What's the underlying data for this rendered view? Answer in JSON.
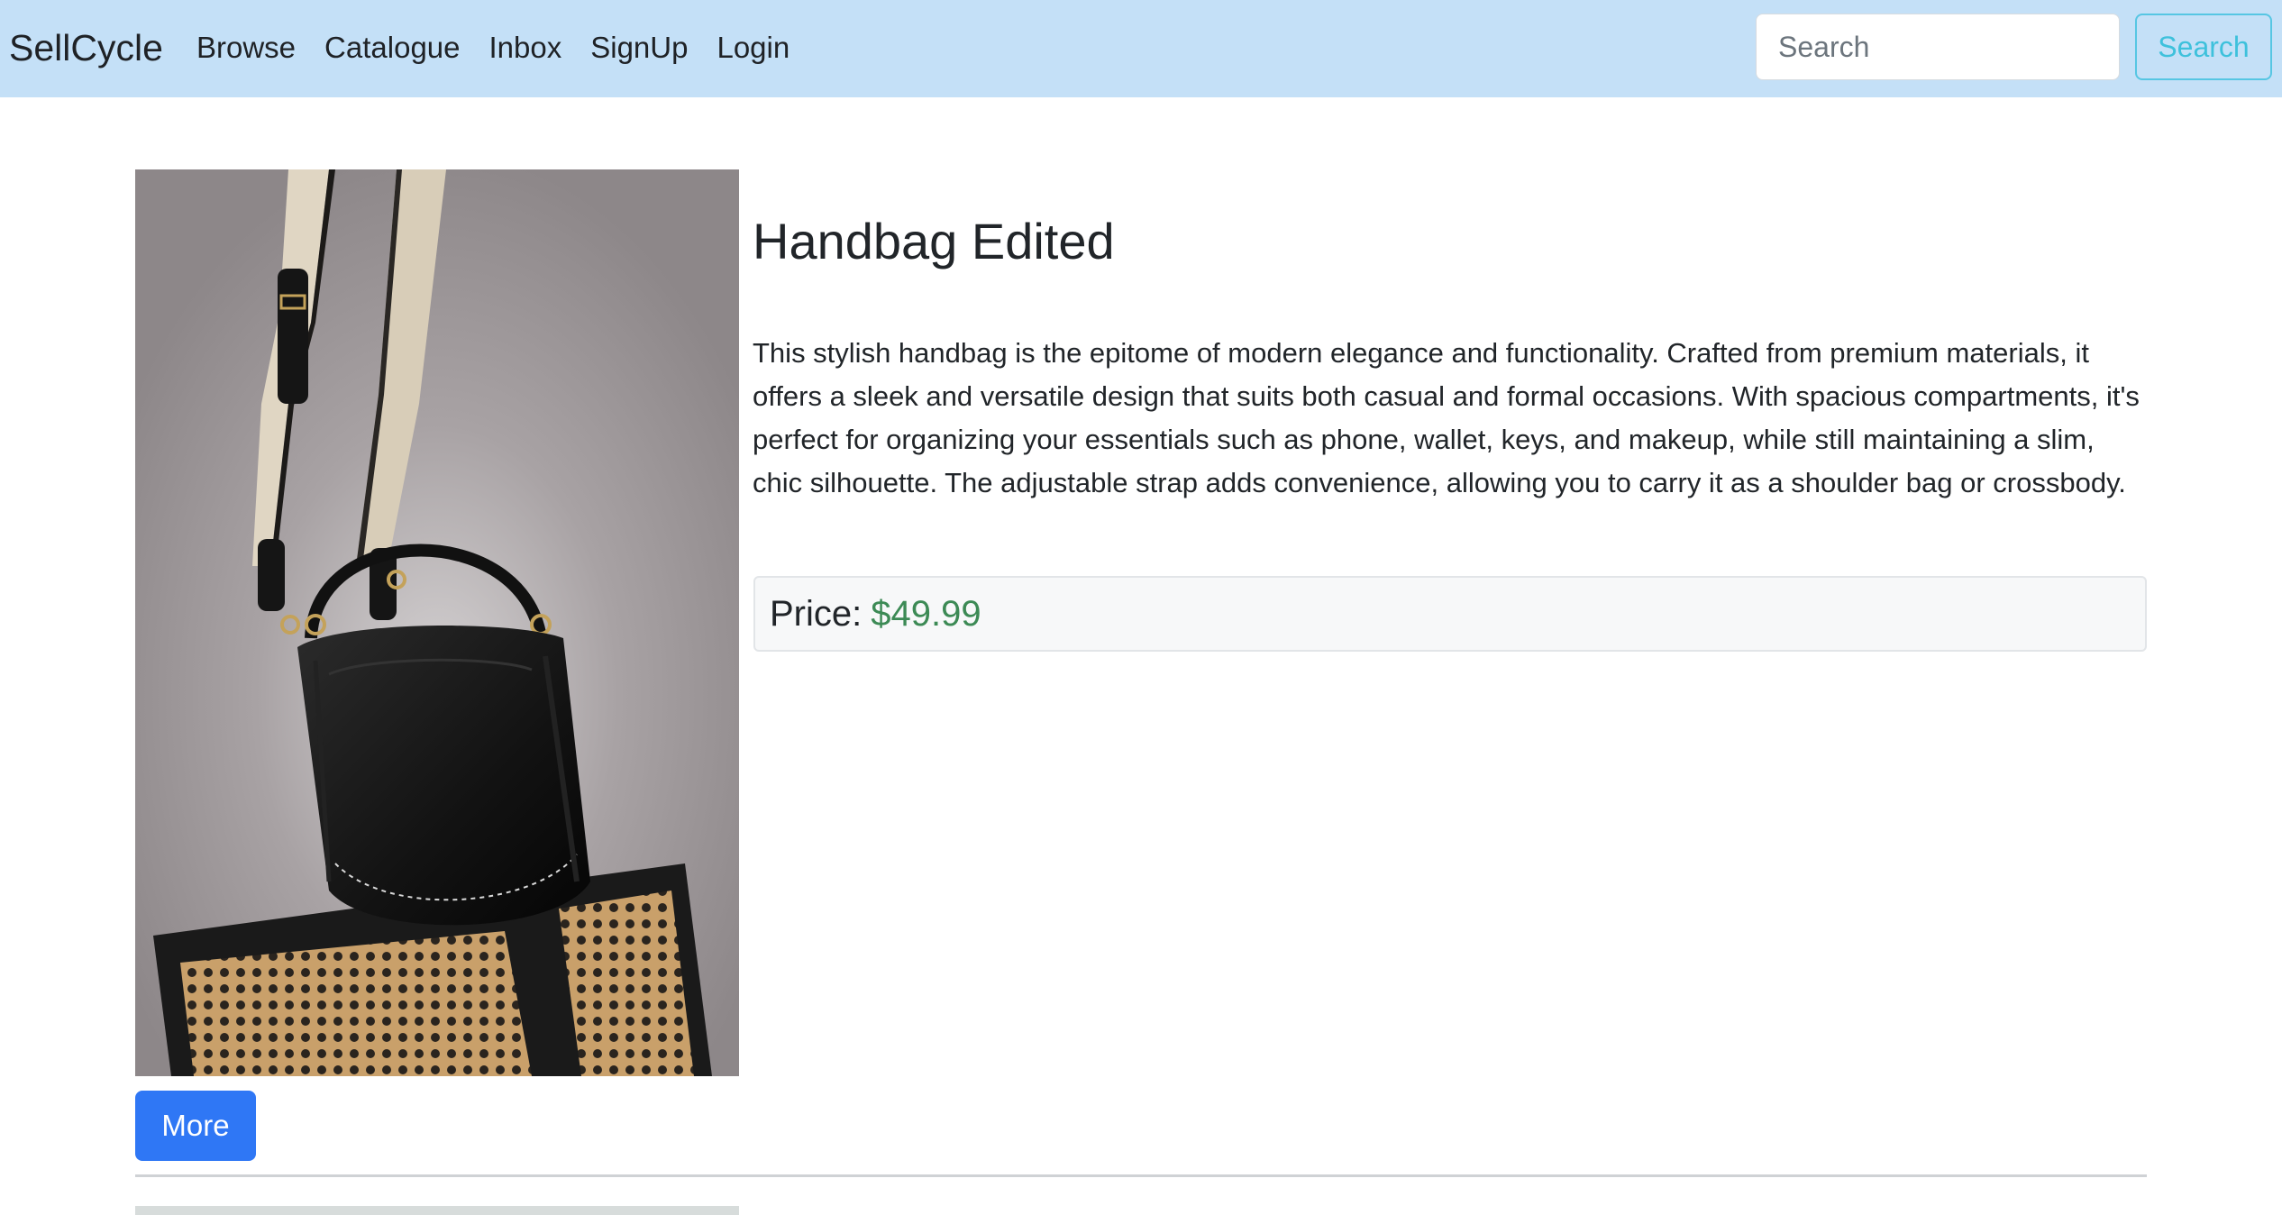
{
  "navbar": {
    "brand": "SellCycle",
    "links": [
      "Browse",
      "Catalogue",
      "Inbox",
      "SignUp",
      "Login"
    ],
    "search_placeholder": "Search",
    "search_button_label": "Search"
  },
  "product": {
    "title": "Handbag Edited",
    "description": "This stylish handbag is the epitome of modern elegance and functionality. Crafted from premium materials, it offers a sleek and versatile design that suits both casual and formal occasions. With spacious compartments, it's perfect for organizing your essentials such as phone, wallet, keys, and makeup, while still maintaining a slim, chic silhouette. The adjustable strap adds convenience, allowing you to carry it as a shoulder bag or crossbody.",
    "price_label": "Price:",
    "price_value": "$49.99",
    "more_button_label": "More"
  },
  "colors": {
    "navbar_bg": "#c4e0f7",
    "search_button_accent": "#3ec1dc",
    "price_green": "#3c8a55",
    "primary_button": "#2f77f5"
  }
}
